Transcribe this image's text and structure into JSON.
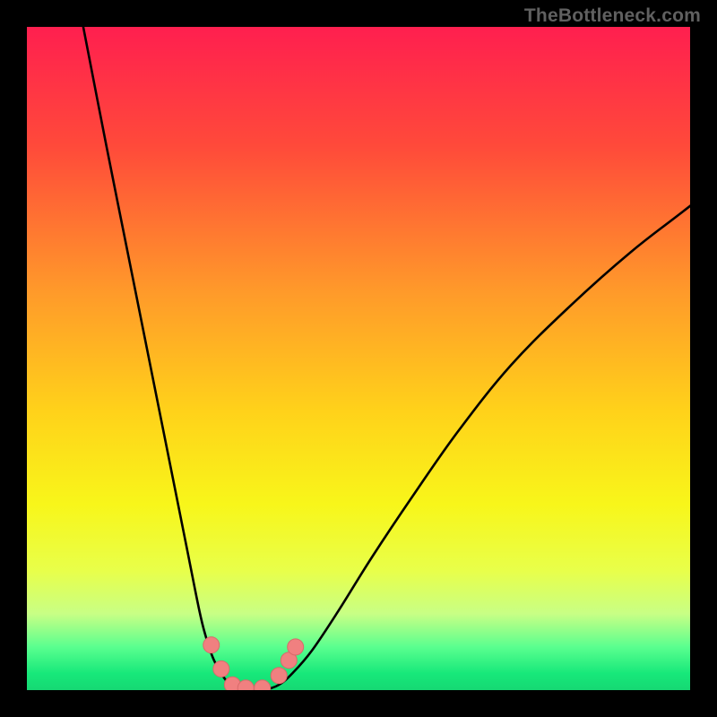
{
  "watermark": "TheBottleneck.com",
  "colors": {
    "frame": "#000000",
    "gradient_stops": [
      {
        "offset": 0.0,
        "color": "#ff1f4f"
      },
      {
        "offset": 0.18,
        "color": "#ff4a3a"
      },
      {
        "offset": 0.4,
        "color": "#ff9a2a"
      },
      {
        "offset": 0.58,
        "color": "#ffd21a"
      },
      {
        "offset": 0.72,
        "color": "#f8f61a"
      },
      {
        "offset": 0.82,
        "color": "#e8ff4a"
      },
      {
        "offset": 0.885,
        "color": "#c8ff85"
      },
      {
        "offset": 0.935,
        "color": "#5aff8f"
      },
      {
        "offset": 0.975,
        "color": "#17e87a"
      },
      {
        "offset": 1.0,
        "color": "#16d873"
      }
    ],
    "curve": "#000000",
    "marker_fill": "#f08080",
    "marker_stroke": "#d86a6a"
  },
  "chart_data": {
    "type": "line",
    "title": "",
    "xlabel": "",
    "ylabel": "",
    "xlim": [
      0,
      100
    ],
    "ylim": [
      0,
      100
    ],
    "series": [
      {
        "name": "left-branch",
        "x": [
          8.5,
          12,
          16,
          20,
          24,
          26,
          27,
          28,
          29,
          30,
          31,
          32
        ],
        "y": [
          100,
          82,
          62,
          42,
          22,
          12,
          8,
          5,
          3,
          1.5,
          0.5,
          0
        ]
      },
      {
        "name": "right-branch",
        "x": [
          36,
          38,
          40,
          43,
          47,
          52,
          58,
          65,
          73,
          82,
          91,
          100
        ],
        "y": [
          0,
          0.8,
          2.5,
          6,
          12,
          20,
          29,
          39,
          49,
          58,
          66,
          73
        ]
      },
      {
        "name": "valley-floor",
        "x": [
          32,
          33,
          34,
          35,
          36
        ],
        "y": [
          0,
          0,
          0,
          0,
          0
        ]
      }
    ],
    "markers": {
      "name": "highlighted-points",
      "points": [
        {
          "x": 27.8,
          "y": 6.8
        },
        {
          "x": 29.3,
          "y": 3.2
        },
        {
          "x": 31.0,
          "y": 0.8
        },
        {
          "x": 33.0,
          "y": 0.3
        },
        {
          "x": 35.5,
          "y": 0.3
        },
        {
          "x": 38.0,
          "y": 2.2
        },
        {
          "x": 39.5,
          "y": 4.5
        },
        {
          "x": 40.5,
          "y": 6.5
        }
      ]
    }
  }
}
